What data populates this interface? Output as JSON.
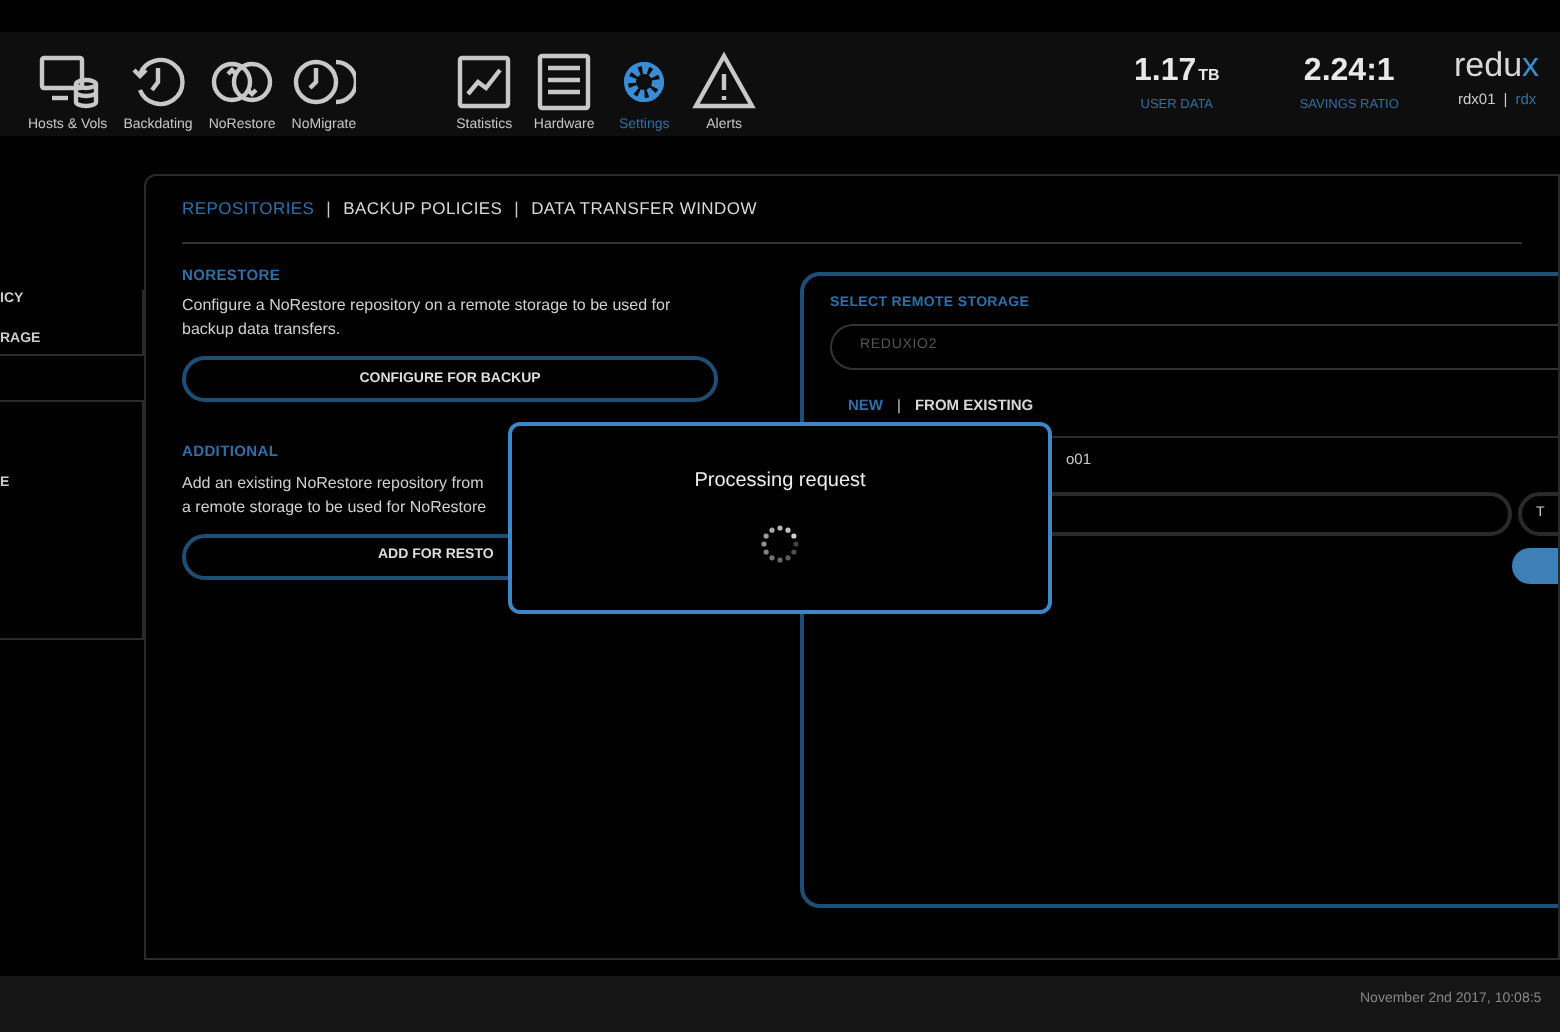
{
  "nav": {
    "items": [
      {
        "label": "Hosts & Vols",
        "kind": "hosts",
        "selected": false
      },
      {
        "label": "Backdating",
        "kind": "clock",
        "selected": false
      },
      {
        "label": "NoRestore",
        "kind": "cycle",
        "selected": false
      },
      {
        "label": "NoMigrate",
        "kind": "clocks",
        "selected": false
      },
      {
        "label": "Statistics",
        "kind": "chart",
        "selected": false
      },
      {
        "label": "Hardware",
        "kind": "rack",
        "selected": false
      },
      {
        "label": "Settings",
        "kind": "gear",
        "selected": true
      },
      {
        "label": "Alerts",
        "kind": "alert",
        "selected": false
      }
    ]
  },
  "stats": [
    {
      "value": "1.17",
      "unit": "TB",
      "label": "USER DATA"
    },
    {
      "value": "2.24:1",
      "label": "SAVINGS RATIO"
    }
  ],
  "brand": {
    "logo": "redu",
    "logo_accent": "x",
    "host": "rdx01",
    "separator": "|",
    "link": "rdx"
  },
  "sidebar": {
    "groups": [
      {
        "items": [
          "ICY",
          "RAGE"
        ]
      },
      {
        "items": [
          "E"
        ]
      }
    ]
  },
  "tabs": [
    {
      "label": "REPOSITORIES",
      "selected": true
    },
    {
      "separator": "|",
      "label": "BACKUP POLICIES",
      "selected": false
    },
    {
      "separator": "|",
      "label": "DATA TRANSFER WINDOW",
      "selected": false
    }
  ],
  "sections": [
    {
      "heading": "NORESTORE",
      "description": "Configure a NoRestore repository on a remote storage to be used for backup data transfers.",
      "button": "CONFIGURE FOR BACKUP"
    },
    {
      "heading": "ADDITIONAL",
      "description": [
        "Add an existing NoRestore repository from",
        "a remote storage to be used for NoRestore"
      ],
      "button": "ADD FOR RESTO"
    }
  ],
  "remote_storage": {
    "heading": "SELECT REMOTE STORAGE",
    "dropdown_value": "REDUXIO2",
    "tabs": [
      {
        "label": "NEW",
        "selected": true
      },
      {
        "separator": "|",
        "label": "FROM EXISTING",
        "selected": false
      }
    ],
    "name_value": "o01",
    "side_button": "T"
  },
  "modal": {
    "message": "Processing request"
  },
  "footer": {
    "timestamp": "November 2nd 2017, 10:08:5"
  }
}
